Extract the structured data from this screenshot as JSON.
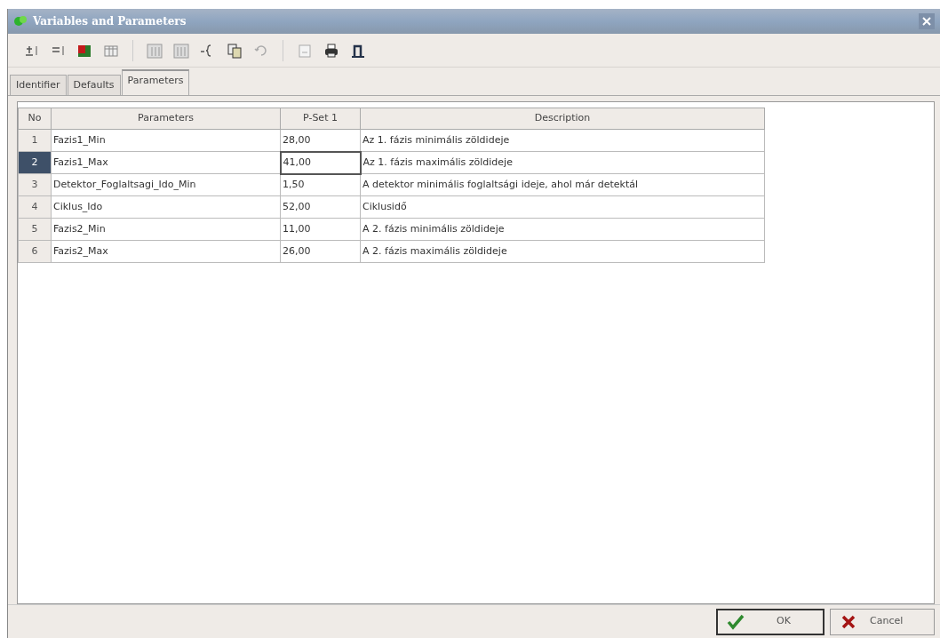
{
  "window": {
    "title": "Variables and Parameters"
  },
  "tabs": [
    {
      "label": "Identifier",
      "selected": false
    },
    {
      "label": "Defaults",
      "selected": false
    },
    {
      "label": "Parameters",
      "selected": true
    }
  ],
  "table": {
    "columns": [
      "No",
      "Parameters",
      "P-Set 1",
      "Description"
    ],
    "rows": [
      {
        "no": "1",
        "name": "Fazis1_Min",
        "value": "28,00",
        "description": "Az 1. fázis minimális zöldideje",
        "selected": false
      },
      {
        "no": "2",
        "name": "Fazis1_Max",
        "value": "41,00",
        "description": "Az 1. fázis maximális zöldideje",
        "selected": true
      },
      {
        "no": "3",
        "name": "Detektor_Foglaltsagi_Ido_Min",
        "value": "1,50",
        "description": "A detektor minimális foglaltsági ideje, ahol már detektál",
        "selected": false
      },
      {
        "no": "4",
        "name": "Ciklus_Ido",
        "value": "52,00",
        "description": "Ciklusidő",
        "selected": false
      },
      {
        "no": "5",
        "name": "Fazis2_Min",
        "value": "11,00",
        "description": "A 2. fázis minimális zöldideje",
        "selected": false
      },
      {
        "no": "6",
        "name": "Fazis2_Max",
        "value": "26,00",
        "description": "A 2. fázis maximális zöldideje",
        "selected": false
      }
    ]
  },
  "buttons": [
    {
      "kind": "ok",
      "label": "OK"
    },
    {
      "kind": "cancel",
      "label": "Cancel"
    }
  ]
}
